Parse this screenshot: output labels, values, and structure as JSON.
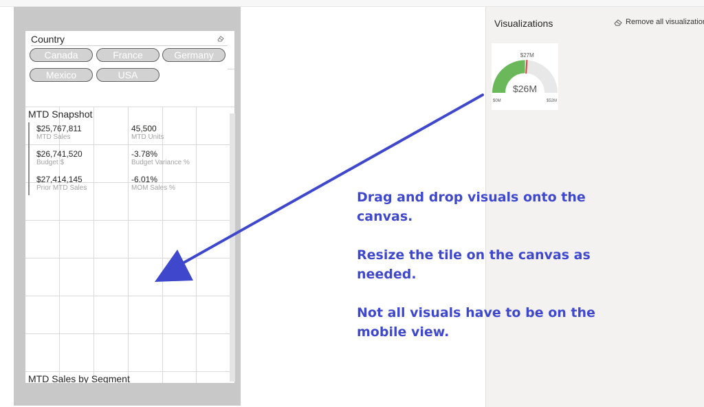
{
  "slicer": {
    "title": "Country",
    "options": [
      "Canada",
      "France",
      "Germany",
      "Mexico",
      "USA"
    ],
    "clear_icon": "eraser-icon"
  },
  "snapshot": {
    "title": "MTD Snapshot",
    "kpis": [
      {
        "value": "$25,767,811",
        "label": "MTD Sales"
      },
      {
        "value": "45,500",
        "label": "MTD Units"
      },
      {
        "value": "$26,741,520",
        "label": "Budget $"
      },
      {
        "value": "-3.78%",
        "label": "Budget Variance %"
      },
      {
        "value": "$27,414,145",
        "label": "Prior MTD Sales"
      },
      {
        "value": "-6.01%",
        "label": "MOM Sales %"
      }
    ]
  },
  "segment": {
    "title": "MTD Sales by Segment"
  },
  "visualizations": {
    "title": "Visualizations",
    "remove_all_label": "Remove all visualizations",
    "remove_icon": "eraser-icon",
    "gauge": {
      "value_label": "$26M",
      "target_label": "$27M",
      "min_label": "$0M",
      "max_label": "$52M",
      "value": 26,
      "target": 27,
      "min": 0,
      "max": 52,
      "fill_color": "#6bb85a",
      "track_color": "#e8e8e8",
      "target_color": "#e0433a"
    }
  },
  "instructions": {
    "line1": "Drag and drop visuals onto the canvas.",
    "line2": "Resize the tile on the canvas as needed.",
    "line3": "Not all visuals have to be on the mobile view.",
    "color": "#3f48cc"
  },
  "arrow": {
    "icon": "arrow-icon",
    "color": "#3f48cc"
  }
}
